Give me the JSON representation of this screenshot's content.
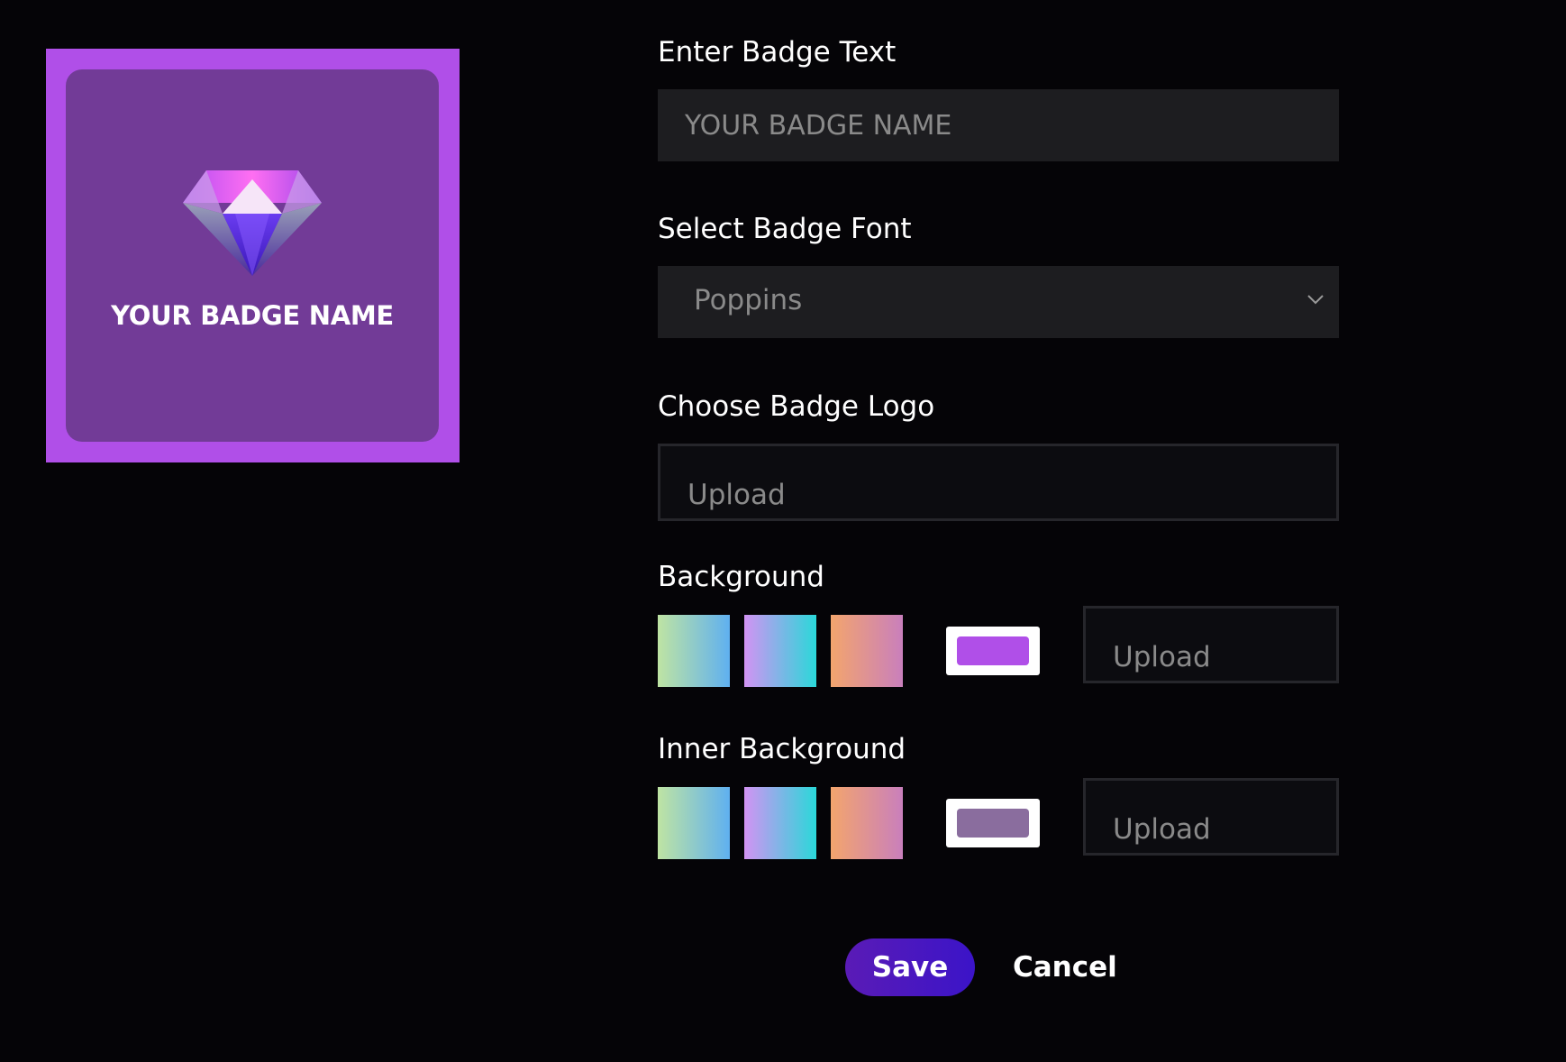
{
  "preview": {
    "badge_name": "YOUR BADGE NAME",
    "logo_icon": "diamond-icon",
    "outer_color": "#b04fe8",
    "inner_color": "#723b97"
  },
  "badge_text": {
    "label": "Enter Badge Text",
    "value": "",
    "placeholder": "YOUR BADGE NAME"
  },
  "badge_font": {
    "label": "Select Badge Font",
    "selected": "Poppins",
    "chevron_icon": "chevron-down-icon"
  },
  "badge_logo": {
    "label": "Choose Badge Logo",
    "upload_label": "Upload"
  },
  "background": {
    "label": "Background",
    "gradients": [
      {
        "from": "#bfe4a3",
        "to": "#5fb0f0"
      },
      {
        "from": "#d293f3",
        "to": "#2ad8d9"
      },
      {
        "from": "#f3a56d",
        "to": "#c97fbc"
      }
    ],
    "selected_color": "#b04fe8",
    "upload_label": "Upload"
  },
  "inner_background": {
    "label": "Inner Background",
    "gradients": [
      {
        "from": "#bfe4a3",
        "to": "#5fb0f0"
      },
      {
        "from": "#d293f3",
        "to": "#2ad8d9"
      },
      {
        "from": "#f3a56d",
        "to": "#c97fbc"
      }
    ],
    "selected_color": "#8a6d9e",
    "upload_label": "Upload"
  },
  "actions": {
    "save_label": "Save",
    "cancel_label": "Cancel"
  }
}
